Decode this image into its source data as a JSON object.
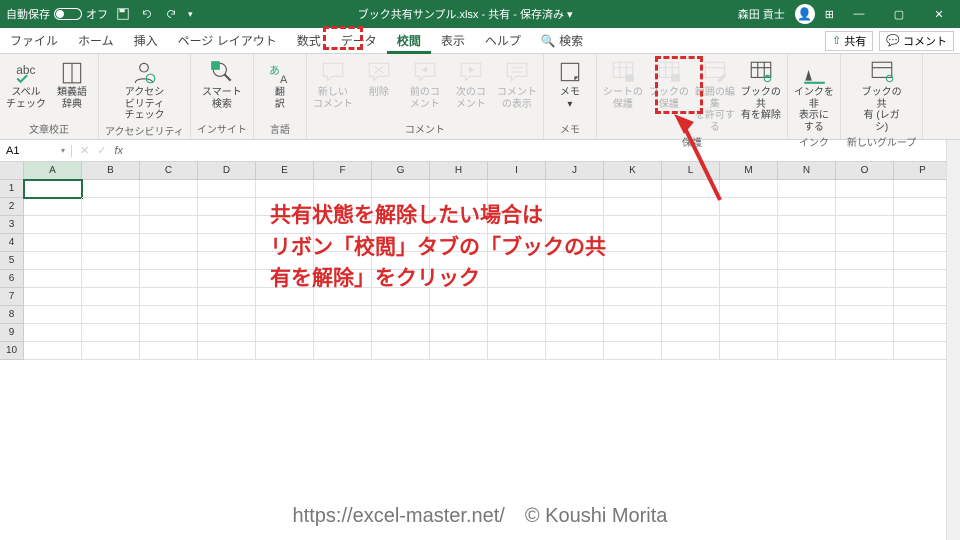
{
  "titlebar": {
    "auto_save": "自動保存",
    "auto_save_state": "オフ",
    "filename": "ブック共有サンプル.xlsx  -  共有  -  保存済み ▾",
    "user": "森田 貢士",
    "win_min": "—",
    "win_max": "▢",
    "win_close": "✕"
  },
  "tabs": [
    "ファイル",
    "ホーム",
    "挿入",
    "ページ レイアウト",
    "数式",
    "データ",
    "校閲",
    "表示",
    "ヘルプ",
    "🔍 検索"
  ],
  "active_tab_index": 6,
  "tab_right": {
    "share": "共有",
    "comment": "コメント"
  },
  "ribbon": {
    "groups": [
      {
        "label": "文章校正",
        "buttons": [
          {
            "name": "spellcheck-button",
            "label": "スペル\nチェック",
            "icon": "abc",
            "disabled": false
          },
          {
            "name": "thesaurus-button",
            "label": "類義語\n辞典",
            "icon": "book",
            "disabled": false
          }
        ]
      },
      {
        "label": "アクセシビリティ",
        "buttons": [
          {
            "name": "accessibility-button",
            "label": "アクセシビリティ\nチェック",
            "icon": "person",
            "disabled": false
          }
        ]
      },
      {
        "label": "インサイト",
        "buttons": [
          {
            "name": "smart-lookup-button",
            "label": "スマート\n検索",
            "icon": "search",
            "disabled": false
          }
        ]
      },
      {
        "label": "言語",
        "buttons": [
          {
            "name": "translate-button",
            "label": "翻\n訳",
            "icon": "translate",
            "disabled": false
          }
        ]
      },
      {
        "label": "コメント",
        "buttons": [
          {
            "name": "new-comment-button",
            "label": "新しい\nコメント",
            "icon": "comment",
            "disabled": true
          },
          {
            "name": "delete-comment-button",
            "label": "削除",
            "icon": "comment-x",
            "disabled": true
          },
          {
            "name": "prev-comment-button",
            "label": "前のコ\nメント",
            "icon": "comment-prev",
            "disabled": true
          },
          {
            "name": "next-comment-button",
            "label": "次のコ\nメント",
            "icon": "comment-next",
            "disabled": true
          },
          {
            "name": "show-comments-button",
            "label": "コメント\nの表示",
            "icon": "comment-show",
            "disabled": true
          }
        ]
      },
      {
        "label": "メモ",
        "buttons": [
          {
            "name": "notes-button",
            "label": "メモ\n▾",
            "icon": "note",
            "disabled": false
          }
        ]
      },
      {
        "label": "保護",
        "buttons": [
          {
            "name": "protect-sheet-button",
            "label": "シートの\n保護",
            "icon": "grid-lock",
            "disabled": true
          },
          {
            "name": "protect-workbook-button",
            "label": "ブックの\n保護",
            "icon": "grid-lock",
            "disabled": true
          },
          {
            "name": "allow-edit-ranges-button",
            "label": "範囲の編集\nを許可する",
            "icon": "grid-edit",
            "disabled": true
          },
          {
            "name": "unshare-workbook-button",
            "label": "ブックの共\n有を解除",
            "icon": "grid-unshare",
            "disabled": false
          }
        ]
      },
      {
        "label": "インク",
        "buttons": [
          {
            "name": "hide-ink-button",
            "label": "インクを非\n表示にする",
            "icon": "pen",
            "disabled": false
          }
        ]
      },
      {
        "label": "新しいグループ",
        "buttons": [
          {
            "name": "share-workbook-legacy-button",
            "label": "ブックの共\n有 (レガシ)",
            "icon": "grid-share",
            "disabled": false
          }
        ]
      }
    ]
  },
  "namebox": {
    "cell": "A1",
    "fx": "fx"
  },
  "columns": [
    "A",
    "B",
    "C",
    "D",
    "E",
    "F",
    "G",
    "H",
    "I",
    "J",
    "K",
    "L",
    "M",
    "N",
    "O",
    "P"
  ],
  "rows": [
    1,
    2,
    3,
    4,
    5,
    6,
    7,
    8,
    9,
    10
  ],
  "annotation": "共有状態を解除したい場合は\nリボン「校閲」タブの「ブックの共\n有を解除」をクリック",
  "footer": "https://excel-master.net/　© Koushi Morita"
}
